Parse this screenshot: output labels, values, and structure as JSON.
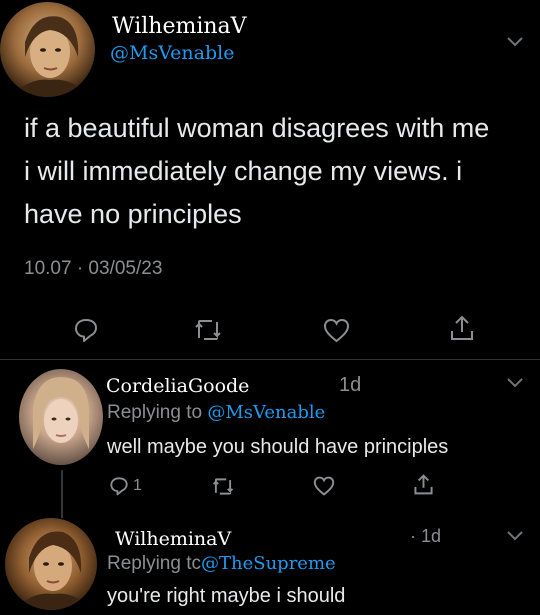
{
  "main_tweet": {
    "display_name": "WilheminaV",
    "handle": "@MsVenable",
    "text": "if a beautiful woman disagrees with me i will immediately change my views. i have no principles",
    "timestamp": "10.07 · 03/05/23"
  },
  "reply_1": {
    "display_name": "CordeliaGoode",
    "age": "1d",
    "replying_prefix": "Replying to",
    "replying_handle": "@MsVenable",
    "text": "well maybe you should have principles",
    "reply_count": "1"
  },
  "reply_2": {
    "display_name": "WilheminaV",
    "age": "· 1d",
    "replying_prefix": "Replying tc",
    "replying_handle": "@TheSupreme",
    "text": "you're right maybe i should"
  },
  "colors": {
    "background": "#000000",
    "accent": "#1d9bf0",
    "muted": "#8b8f93"
  }
}
